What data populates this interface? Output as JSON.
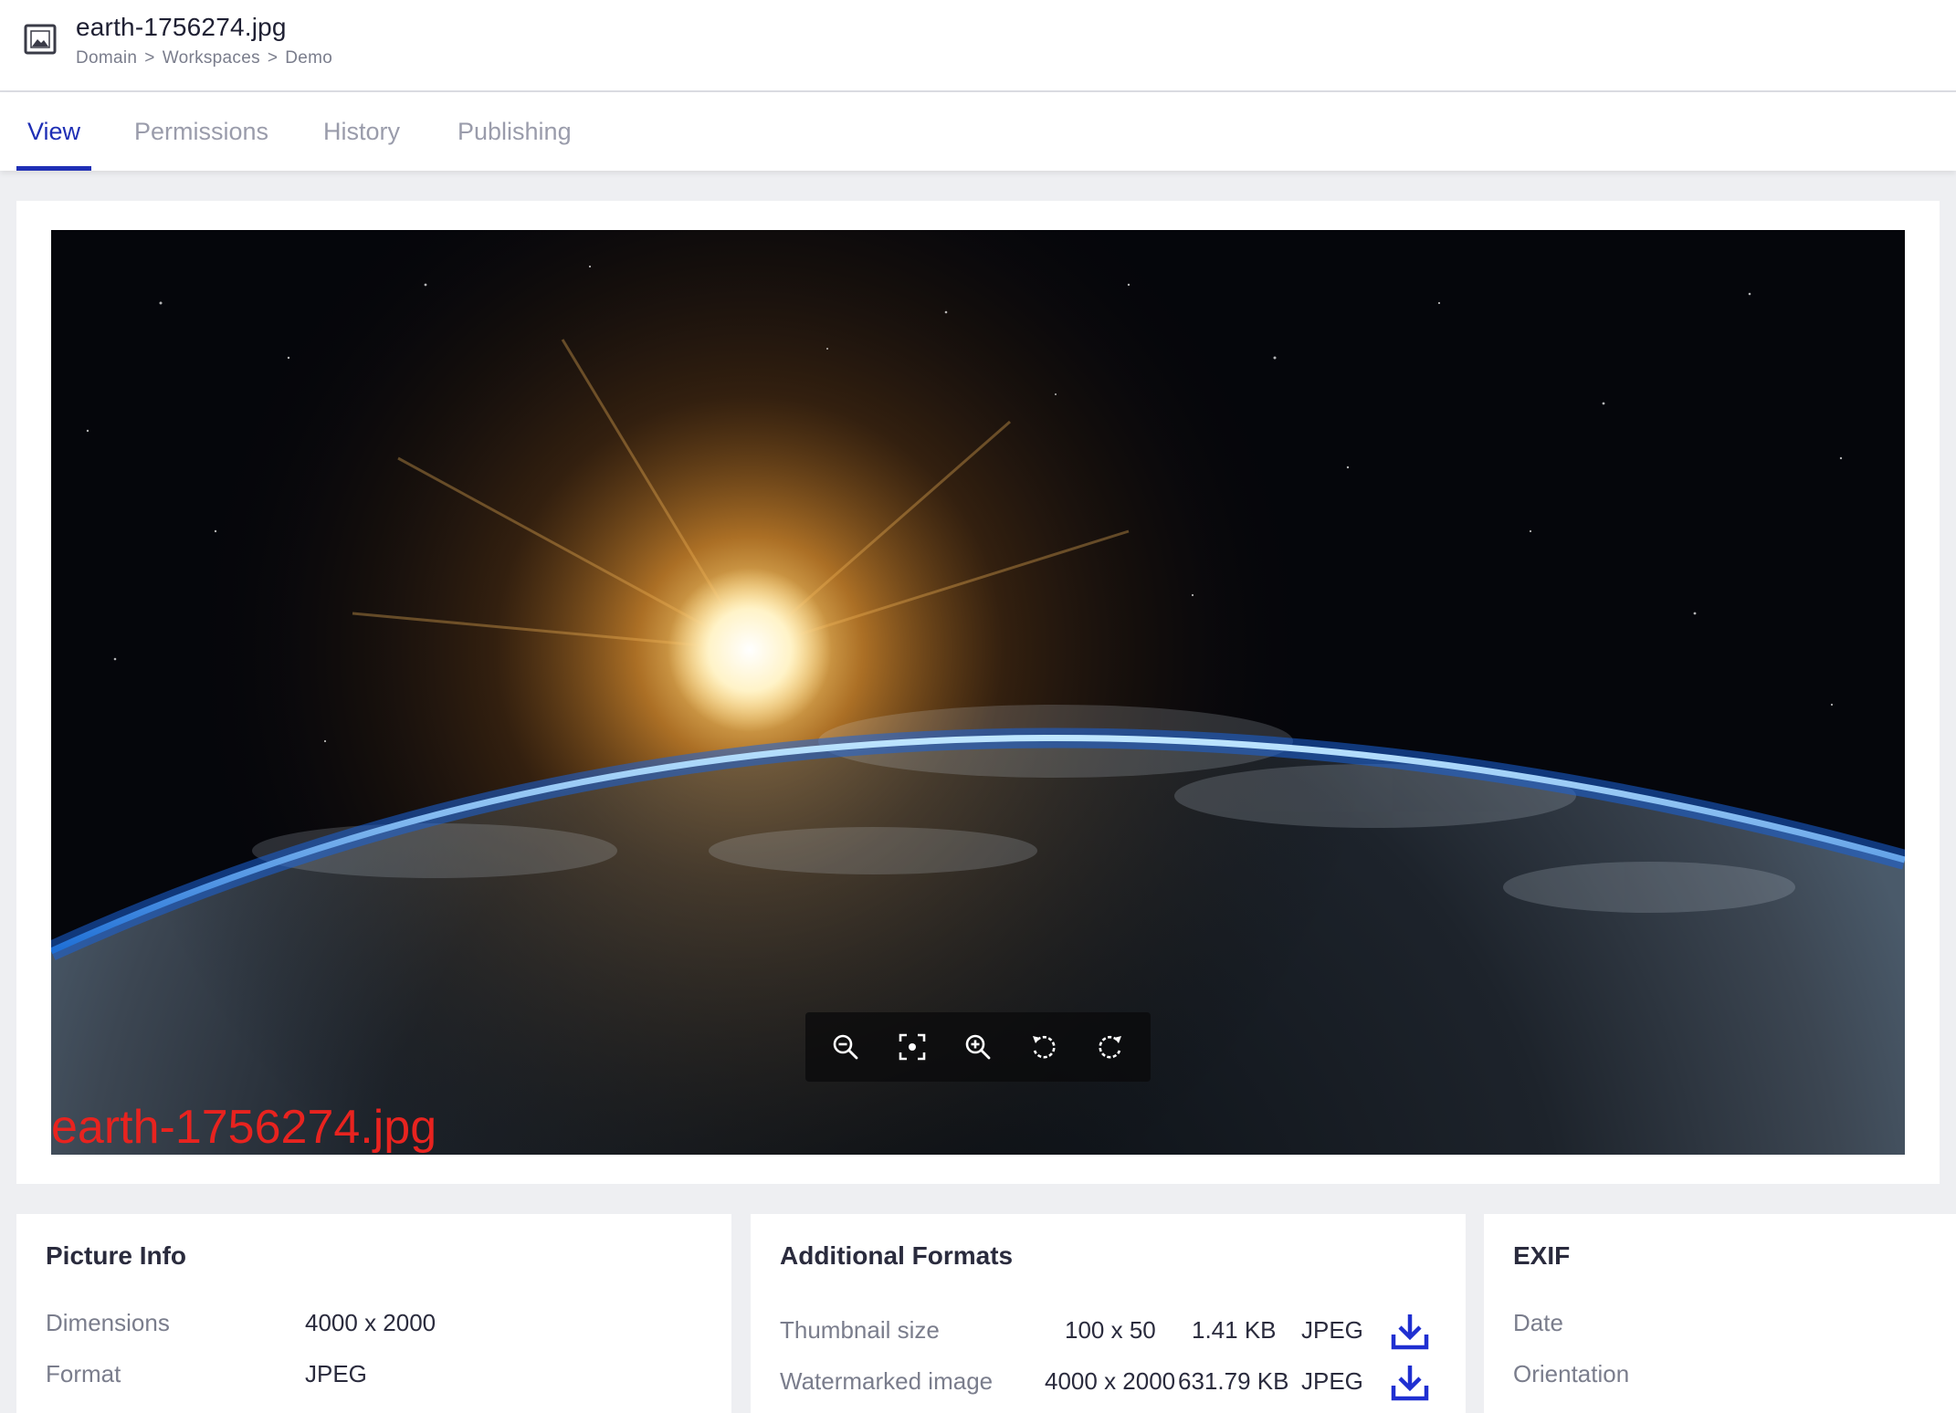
{
  "header": {
    "title": "earth-1756274.jpg",
    "breadcrumb": [
      "Domain",
      "Workspaces",
      "Demo"
    ],
    "breadcrumb_separator": ">",
    "icon": "image-icon"
  },
  "tabs": [
    {
      "label": "View",
      "active": true
    },
    {
      "label": "Permissions",
      "active": false
    },
    {
      "label": "History",
      "active": false
    },
    {
      "label": "Publishing",
      "active": false
    }
  ],
  "viewer": {
    "watermark_text": "earth-1756274.jpg",
    "toolbar": [
      "zoom-out-icon",
      "fit-screen-icon",
      "zoom-in-icon",
      "rotate-left-icon",
      "rotate-right-icon"
    ]
  },
  "picture_info": {
    "title": "Picture Info",
    "rows": [
      {
        "label": "Dimensions",
        "value": "4000 x 2000"
      },
      {
        "label": "Format",
        "value": "JPEG"
      }
    ]
  },
  "additional_formats": {
    "title": "Additional Formats",
    "rows": [
      {
        "label": "Thumbnail size",
        "dimensions": "100 x 50",
        "size": "1.41 KB",
        "format": "JPEG",
        "icon": "download-icon"
      },
      {
        "label": "Watermarked image",
        "dimensions": "4000 x 2000",
        "size": "631.79 KB",
        "format": "JPEG",
        "icon": "download-icon"
      }
    ]
  },
  "exif": {
    "title": "EXIF",
    "rows": [
      {
        "label": "Date"
      },
      {
        "label": "Orientation"
      }
    ]
  },
  "colors": {
    "accent": "#1f2fb5",
    "watermark": "#e8231f",
    "download": "#1f2fd1"
  }
}
